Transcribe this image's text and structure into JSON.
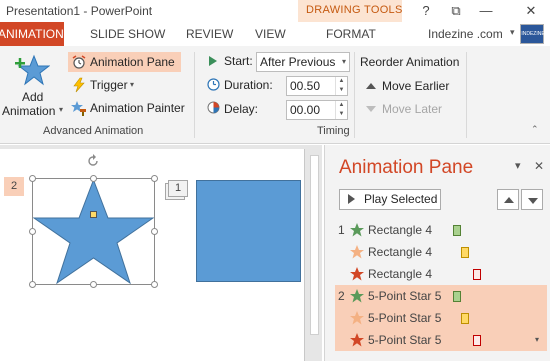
{
  "titlebar": {
    "app_title": "Presentation1 - PowerPoint",
    "contextual_group": "DRAWING TOOLS",
    "help": "?",
    "restore": "⧉",
    "minimize": "—",
    "close": "✕"
  },
  "tabs": {
    "animations": "ANIMATIONS",
    "slide_show": "SLIDE SHOW",
    "review": "REVIEW",
    "view": "VIEW",
    "format": "FORMAT",
    "account": "Indezine .com",
    "account_caret": "▾",
    "avatar_text": "INDEZINE"
  },
  "ribbon": {
    "add_animation": {
      "line1": "Add",
      "line2": "Animation",
      "caret": "▾"
    },
    "animation_pane": "Animation Pane",
    "trigger": "Trigger",
    "trigger_caret": "▾",
    "animation_painter": "Animation Painter",
    "group_advanced": "Advanced Animation",
    "start_label": "Start:",
    "start_value": "After Previous",
    "duration_label": "Duration:",
    "duration_value": "00.50",
    "delay_label": "Delay:",
    "delay_value": "00.00",
    "group_timing": "Timing",
    "reorder_heading": "Reorder Animation",
    "move_earlier": "Move Earlier",
    "move_later": "Move Later",
    "collapse": "⌃"
  },
  "slide": {
    "badge_star": "2",
    "badge_rect": "1"
  },
  "pane": {
    "title": "Animation Pane",
    "pin": "▾",
    "close": "✕",
    "play_selected": "Play Selected",
    "items": [
      {
        "num": "1",
        "label": "Rectangle 4",
        "effect": "entrance",
        "bar_color": "#a9d18e",
        "bar_border": "#548235"
      },
      {
        "num": "",
        "label": "Rectangle 4",
        "effect": "emphasis",
        "bar_color": "#ffd966",
        "bar_border": "#bf9000"
      },
      {
        "num": "",
        "label": "Rectangle 4",
        "effect": "exit",
        "bar_color": "#fde9e7",
        "bar_border": "#c00000"
      },
      {
        "num": "2",
        "label": "5-Point Star 5",
        "effect": "entrance",
        "bar_color": "#a9d18e",
        "bar_border": "#548235"
      },
      {
        "num": "",
        "label": "5-Point Star 5",
        "effect": "emphasis",
        "bar_color": "#ffd966",
        "bar_border": "#bf9000"
      },
      {
        "num": "",
        "label": "5-Point Star 5",
        "effect": "exit",
        "bar_color": "#fde9e7",
        "bar_border": "#c00000"
      }
    ],
    "row_scroll": "▾"
  },
  "colors": {
    "accent": "#d24726",
    "selection": "#f9cfb8",
    "shape_fill": "#5b9bd5",
    "entrance_star": "#5a9a5a",
    "emphasis_star": "#f4b183",
    "exit_star": "#d24726"
  }
}
